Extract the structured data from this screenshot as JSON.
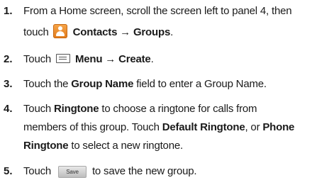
{
  "steps": [
    {
      "number": "1.",
      "line1": {
        "pre": "From a Home screen, scroll the screen left to panel 4, then"
      },
      "line2": {
        "pre": "touch",
        "bold1": "Contacts → Groups",
        "post": "."
      },
      "icon": "contacts-icon"
    },
    {
      "number": "2.",
      "pre": "Touch",
      "bold1": "Menu → Create",
      "post": ".",
      "icon": "menu-icon"
    },
    {
      "number": "3.",
      "pre": "Touch the ",
      "bold1": "Group Name",
      "post": " field to enter a Group Name."
    },
    {
      "number": "4.",
      "line1": {
        "pre": "Touch ",
        "bold1": "Ringtone",
        "post": " to choose a ringtone for calls from"
      },
      "line2": {
        "pre": "members of this group. Touch ",
        "bold1": "Default Ringtone",
        "mid": ", or ",
        "bold2": "Phone"
      },
      "line3": {
        "bold1": "Ringtone",
        "post": " to select a new ringtone."
      }
    },
    {
      "number": "5.",
      "pre": "Touch",
      "button_label": "Save",
      "post": "to save the new group."
    }
  ]
}
